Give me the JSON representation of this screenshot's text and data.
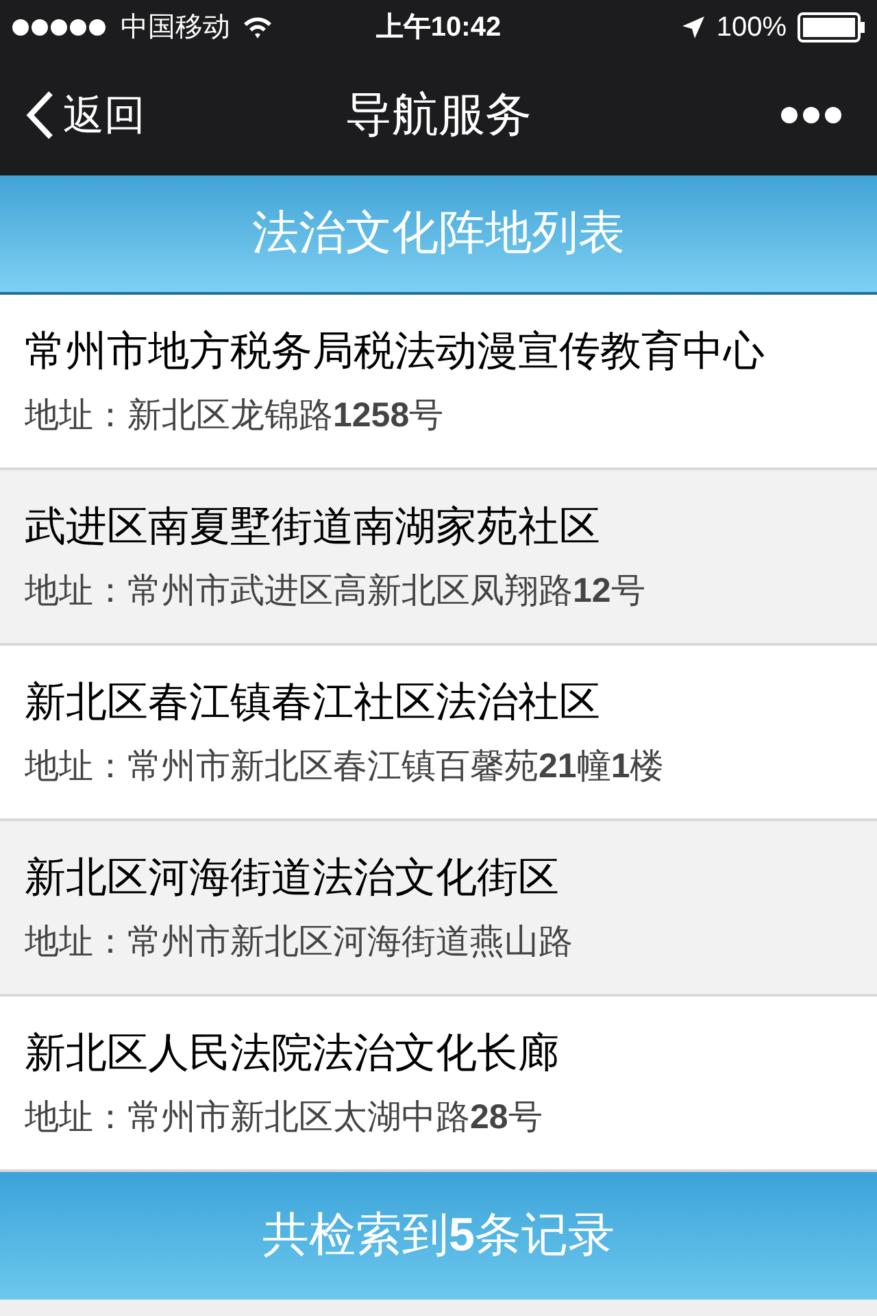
{
  "status_bar": {
    "carrier": "中国移动",
    "time": "上午10:42",
    "battery": "100%"
  },
  "nav_bar": {
    "back": "返回",
    "title": "导航服务"
  },
  "list_header": "法治文化阵地列表",
  "items": [
    {
      "name": "常州市地方税务局税法动漫宣传教育中心",
      "address_label": "地址：",
      "address": "新北区龙锦路**1258**号"
    },
    {
      "name": "武进区南夏墅街道南湖家苑社区",
      "address_label": "地址：",
      "address": "常州市武进区高新北区凤翔路**12**号"
    },
    {
      "name": "新北区春江镇春江社区法治社区",
      "address_label": "地址：",
      "address": "常州市新北区春江镇百馨苑**21**幢**1**楼"
    },
    {
      "name": "新北区河海街道法治文化街区",
      "address_label": "地址：",
      "address": "常州市新北区河海街道燕山路"
    },
    {
      "name": "新北区人民法院法治文化长廊",
      "address_label": "地址：",
      "address": "常州市新北区太湖中路**28**号"
    }
  ],
  "footer": "共检索到**5**条记录"
}
